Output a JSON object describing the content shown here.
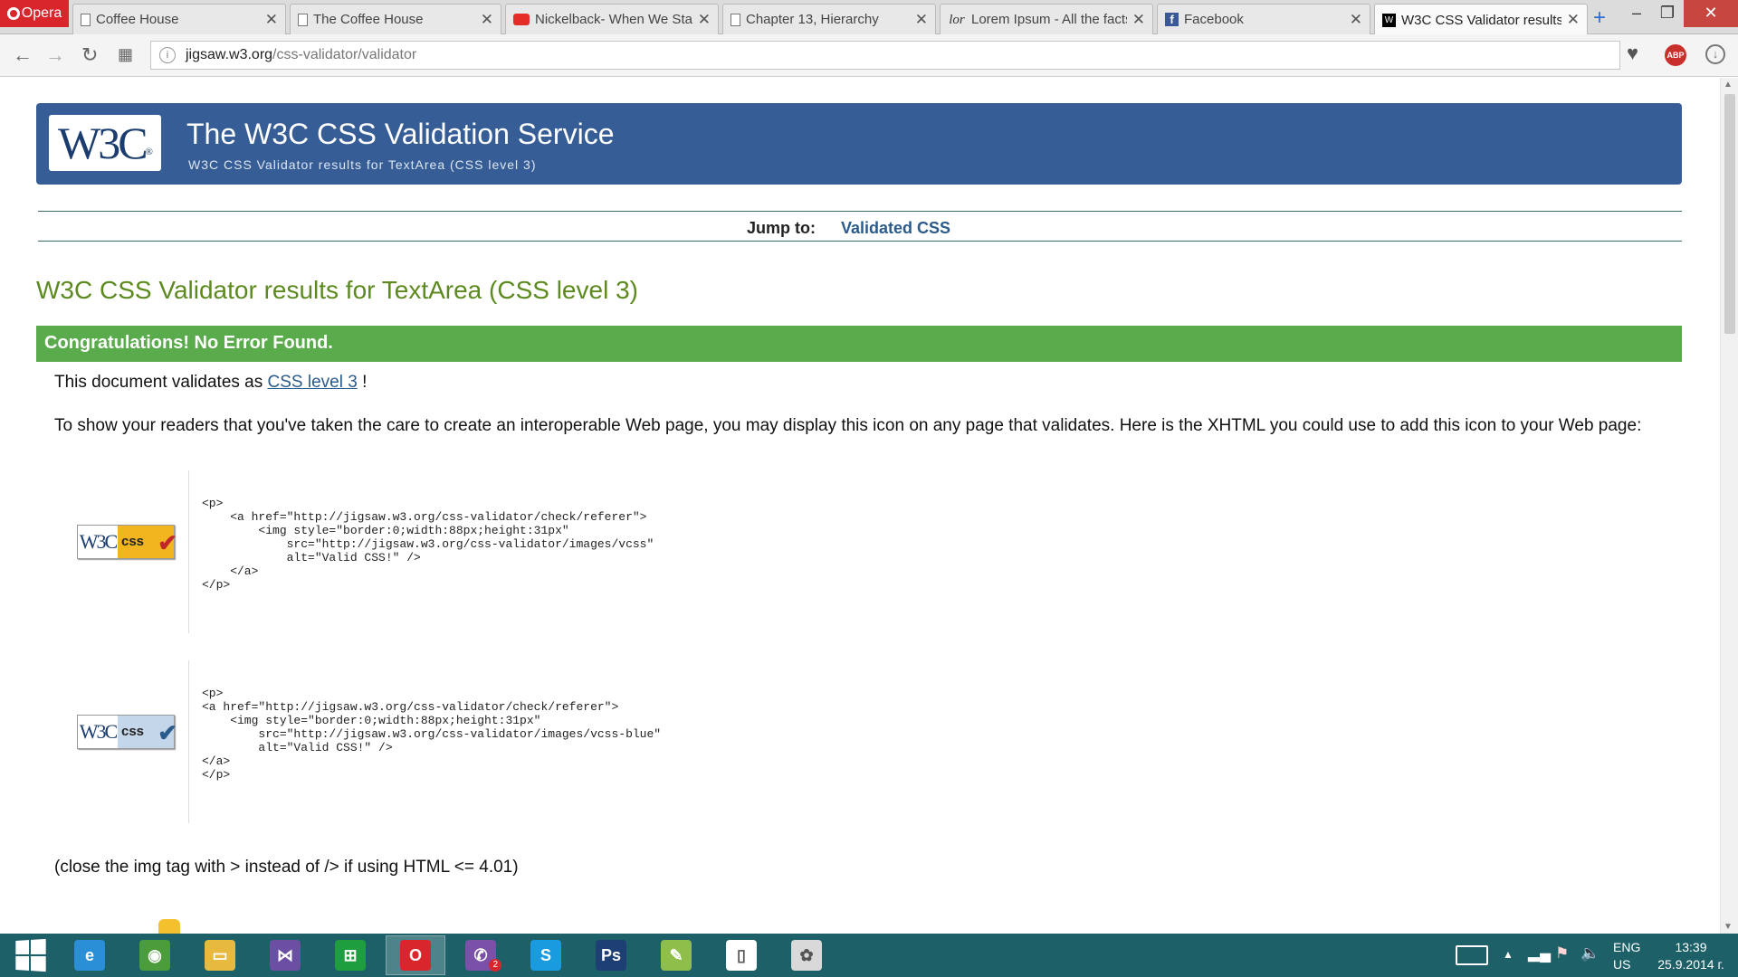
{
  "browser": {
    "menu_label": "Opera",
    "tabs": [
      {
        "title": "Coffee House",
        "icon": "doc-icon"
      },
      {
        "title": "The Coffee House",
        "icon": "doc-icon"
      },
      {
        "title": "Nickelback- When We Stand Together",
        "icon": "youtube-icon"
      },
      {
        "title": "Chapter 13, Hierarchy",
        "icon": "doc-icon"
      },
      {
        "title": "Lorem Ipsum - All the facts",
        "icon": "lorem-icon",
        "icon_text": "lor"
      },
      {
        "title": "Facebook",
        "icon": "facebook-icon",
        "icon_text": "f"
      },
      {
        "title": "W3C CSS Validator results",
        "icon": "w3c-icon",
        "active": true
      }
    ],
    "url_host": "jigsaw.w3.org",
    "url_prefix": "",
    "url_path": "/css-validator/validator",
    "adblock_label": "ABP"
  },
  "page": {
    "service_title": "The W3C CSS Validation Service",
    "service_subtitle": "W3C CSS Validator results for TextArea (CSS level 3)",
    "logo_text": "W3C",
    "jump_label": "Jump to:",
    "jump_link": "Validated CSS",
    "results_heading": "W3C CSS Validator results for TextArea (CSS level 3)",
    "congrats": "Congratulations! No Error Found.",
    "validates_prefix": "This document validates as",
    "validates_link": "CSS level 3",
    "validates_suffix": " !",
    "readers_text": "To show your readers that you've taken the care to create an interoperable Web page, you may display this icon on any page that validates. Here is the XHTML you could use to add this icon to your Web page:",
    "badge_w3c": "W3C",
    "badge_css": "css",
    "code_gold": "<p>\n    <a href=\"http://jigsaw.w3.org/css-validator/check/referer\">\n        <img style=\"border:0;width:88px;height:31px\"\n            src=\"http://jigsaw.w3.org/css-validator/images/vcss\"\n            alt=\"Valid CSS!\" />\n    </a>\n</p>",
    "code_blue": "<p>\n<a href=\"http://jigsaw.w3.org/css-validator/check/referer\">\n    <img style=\"border:0;width:88px;height:31px\"\n        src=\"http://jigsaw.w3.org/css-validator/images/vcss-blue\"\n        alt=\"Valid CSS!\" />\n</a>\n</p>",
    "close_note": "(close the img tag with > instead of /> if using HTML <= 4.01)"
  },
  "taskbar": {
    "apps": [
      {
        "name": "internet-explorer",
        "glyph": "e",
        "color": "#2b8fd8"
      },
      {
        "name": "chrome",
        "glyph": "◉",
        "color": "#4b9c3b"
      },
      {
        "name": "file-explorer",
        "glyph": "▭",
        "color": "#e7b93f"
      },
      {
        "name": "visual-studio",
        "glyph": "⋈",
        "color": "#6a4fa3"
      },
      {
        "name": "windows-store",
        "glyph": "⊞",
        "color": "#1e9e3f"
      },
      {
        "name": "opera",
        "glyph": "O",
        "color": "#d8262c",
        "active": true
      },
      {
        "name": "viber",
        "glyph": "✆",
        "color": "#7a50a8",
        "badge": "2"
      },
      {
        "name": "skype",
        "glyph": "S",
        "color": "#1a9be0"
      },
      {
        "name": "photoshop",
        "glyph": "Ps",
        "color": "#1e3f73"
      },
      {
        "name": "notepad-plus",
        "glyph": "✎",
        "color": "#8fbf4a"
      },
      {
        "name": "notepad",
        "glyph": "▯",
        "color": "#ffffff"
      },
      {
        "name": "paint",
        "glyph": "✿",
        "color": "#d9d9d9"
      }
    ],
    "lang_top": "ENG",
    "lang_bottom": "US",
    "time": "13:39",
    "date": "25.9.2014 г."
  },
  "colors": {
    "banner": "#365d95",
    "success": "#5aab4b",
    "heading": "#5d8a1f",
    "link": "#2a5b8b",
    "taskbar": "#1d6068"
  }
}
